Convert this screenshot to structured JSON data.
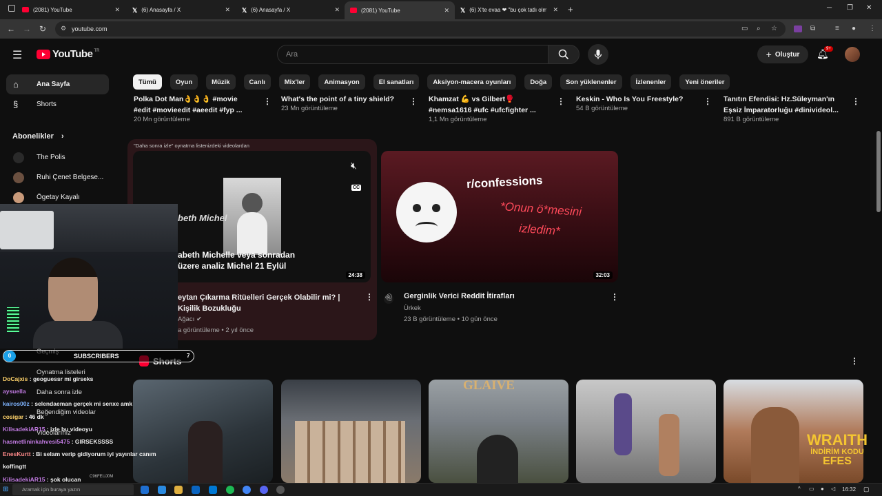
{
  "browser": {
    "tabs": [
      {
        "title": "(2081) YouTube",
        "icon": "youtube-icon",
        "active": false
      },
      {
        "title": "(6) Anasayfa / X",
        "icon": "x-icon",
        "active": false
      },
      {
        "title": "(6) Anasayfa / X",
        "icon": "x-icon",
        "active": false
      },
      {
        "title": "(2081) YouTube",
        "icon": "youtube-icon",
        "active": true
      },
      {
        "title": "(6) X'te evaa ❤ \"bu çok tatlı olm",
        "icon": "x-icon",
        "active": false
      }
    ],
    "url": "youtube.com"
  },
  "header": {
    "logo_text": "YouTube",
    "country": "TR",
    "search_placeholder": "Ara",
    "create_label": "Oluştur",
    "notification_badge": "9+"
  },
  "chips": [
    "Tümü",
    "Oyun",
    "Müzik",
    "Canlı",
    "Mix'ler",
    "Animasyon",
    "El sanatları",
    "Aksiyon-macera oyunları",
    "Doğa",
    "Son yüklenenler",
    "İzlenenler",
    "Yeni öneriler"
  ],
  "sidebar": {
    "items": [
      {
        "label": "Ana Sayfa",
        "icon": "home-icon",
        "active": true
      },
      {
        "label": "Shorts",
        "icon": "shorts-icon",
        "active": false
      }
    ],
    "subscriptions_title": "Abonelikler",
    "subscriptions": [
      {
        "name": "The Polis"
      },
      {
        "name": "Ruhi Çenet Belgese..."
      },
      {
        "name": "Ögetay Kayalı"
      }
    ],
    "lower_items": [
      {
        "label": "Geçmiş"
      },
      {
        "label": "Oynatma listeleri"
      },
      {
        "label": "Daha sonra izle"
      },
      {
        "label": "Videolarınız"
      },
      {
        "label": "Beğendiğim videolar"
      }
    ]
  },
  "top_row": [
    {
      "title_line1": "Polka Dot Man👌👌👌 #movie",
      "title_line2": "#edit #movieedit #aeedit #fyp ...",
      "views": "20 Mn görüntüleme"
    },
    {
      "title_line1": "What's the point of a tiny shield?",
      "title_line2": "",
      "views": "23 Mn görüntüleme"
    },
    {
      "title_line1": "Khamzat 💪 vs Gilbert🥊",
      "title_line2": "#nemsa1616 #ufc #ufcfighter ...",
      "views": "1,1 Mn görüntüleme"
    },
    {
      "title_line1": "Keskin - Who Is You Freestyle?",
      "title_line2": "",
      "views": "54 B görüntüleme"
    },
    {
      "title_line1": "Tanıtın Efendisi: Hz.Süleyman'ın",
      "title_line2": "Eşsiz İmparatorluğu #dinivideol...",
      "views": "891 B görüntüleme"
    }
  ],
  "watch_later": {
    "header": "\"Daha sonra izle\" oynatma listenizdeki videolardan",
    "video": {
      "thumb_text_line1": "abeth Michelle veya sonradan",
      "thumb_text_line2": "üzere analiz Michel 21 Eylül",
      "thumb_side_text": "beth Michel",
      "duration": "24:38",
      "title_line1": "eytan Çıkarma Ritüelleri Gerçek Olabilir mi? |",
      "title_line2": "Kişilik Bozukluğu",
      "channel": "Ağacı",
      "meta": "a görüntüleme • 2 yıl önce"
    }
  },
  "video2": {
    "thumb_title": "r/confessions",
    "thumb_caption_line1": "*Onun ö*mesini",
    "thumb_caption_line2": "izledim*",
    "duration": "32:03",
    "title": "Gerginlik Verici Reddit İtirafları",
    "channel": "Ürkek",
    "meta": "23 B görüntüleme • 10 gün önce"
  },
  "shorts": {
    "label": "Shorts",
    "items": [
      {
        "overlay": ""
      },
      {
        "overlay": ""
      },
      {
        "overlay": "GLAIVE"
      },
      {
        "overlay": ""
      },
      {
        "overlay": "WRAITH",
        "overlay2": "İNDİRİM KODU",
        "overlay3": "EFES"
      }
    ]
  },
  "stream_overlay": {
    "sub_count": "0",
    "sub_label": "SUBSCRIBERS",
    "sub_goal": "7",
    "chat": [
      {
        "user": "DoCajxis",
        "msg": "geoguessr mi girseks"
      },
      {
        "user": "aysuella",
        "msg": ""
      },
      {
        "user": "kairos00z",
        "msg": "selendaeman gerçek mi senxe amk"
      },
      {
        "user": "cosigar",
        "msg": "46 dk"
      },
      {
        "user": "KilisadekiAR15",
        "msg": "izle bu videoyu"
      },
      {
        "user": "hasmetlininkahvesi5475",
        "msg": "GIRSEKSSSS"
      },
      {
        "user": "EnesKurtt",
        "msg": "Bi selam verip gidiyorum iyi yayınlar canım"
      },
      {
        "user": "koffingtt",
        "msg": ""
      },
      {
        "user": "KilisadekiAR15",
        "msg": "şok olucan"
      }
    ],
    "ticker": "C96FEUJ0M"
  },
  "taskbar": {
    "search_text": "Aramak için buraya yazın",
    "time": "16:32"
  },
  "colors": {
    "yt_red": "#ff0033",
    "bg": "#0f0f0f",
    "chip_bg": "#272727",
    "card_bg": "#2b1619"
  }
}
